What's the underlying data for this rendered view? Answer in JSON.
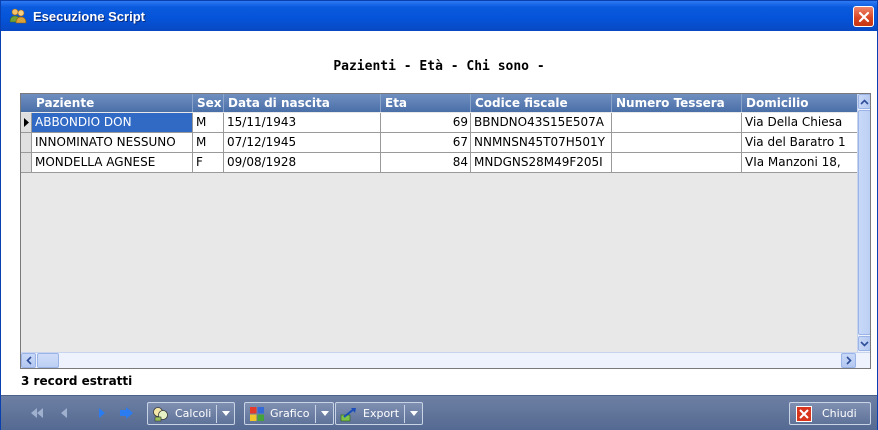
{
  "window": {
    "title": "Esecuzione Script"
  },
  "report": {
    "title": "Pazienti - Età - Chi sono -"
  },
  "table": {
    "columns": [
      "Paziente",
      "Sex",
      "Data di nascita",
      "Eta",
      "Codice fiscale",
      "Numero Tessera",
      "Domicilio"
    ],
    "rows": [
      {
        "paziente": "ABBONDIO DON",
        "sex": "M",
        "data": "15/11/1943",
        "eta": "69",
        "cf": "BBNDNO43S15E507A",
        "tessera": "",
        "domicilio": "Via Della Chiesa"
      },
      {
        "paziente": "INNOMINATO NESSUNO",
        "sex": "M",
        "data": "07/12/1945",
        "eta": "67",
        "cf": "NNMNSN45T07H501Y",
        "tessera": "",
        "domicilio": "Via del Baratro 1"
      },
      {
        "paziente": "MONDELLA AGNESE",
        "sex": "F",
        "data": "09/08/1928",
        "eta": "84",
        "cf": "MNDGNS28M49F205I",
        "tessera": "",
        "domicilio": "VIa Manzoni 18,"
      }
    ]
  },
  "status": {
    "text": "3 record estratti"
  },
  "toolbar": {
    "calcoli": "Calcoli",
    "grafico": "Grafico",
    "export": "Export",
    "chiudi": "Chiudi"
  },
  "icons": {
    "window": "users-icon",
    "close": "close-icon",
    "first": "first-record-icon",
    "prev": "prev-record-icon",
    "next": "next-record-icon",
    "last": "last-record-icon",
    "calcoli": "calculator-icon",
    "grafico": "chart-icon",
    "export": "export-icon",
    "chiudi": "close-icon"
  },
  "colors": {
    "titlebar": "#0553d8",
    "header": "#4a6fa8",
    "selection": "#316ac5",
    "toolbar": "#5f7298"
  }
}
